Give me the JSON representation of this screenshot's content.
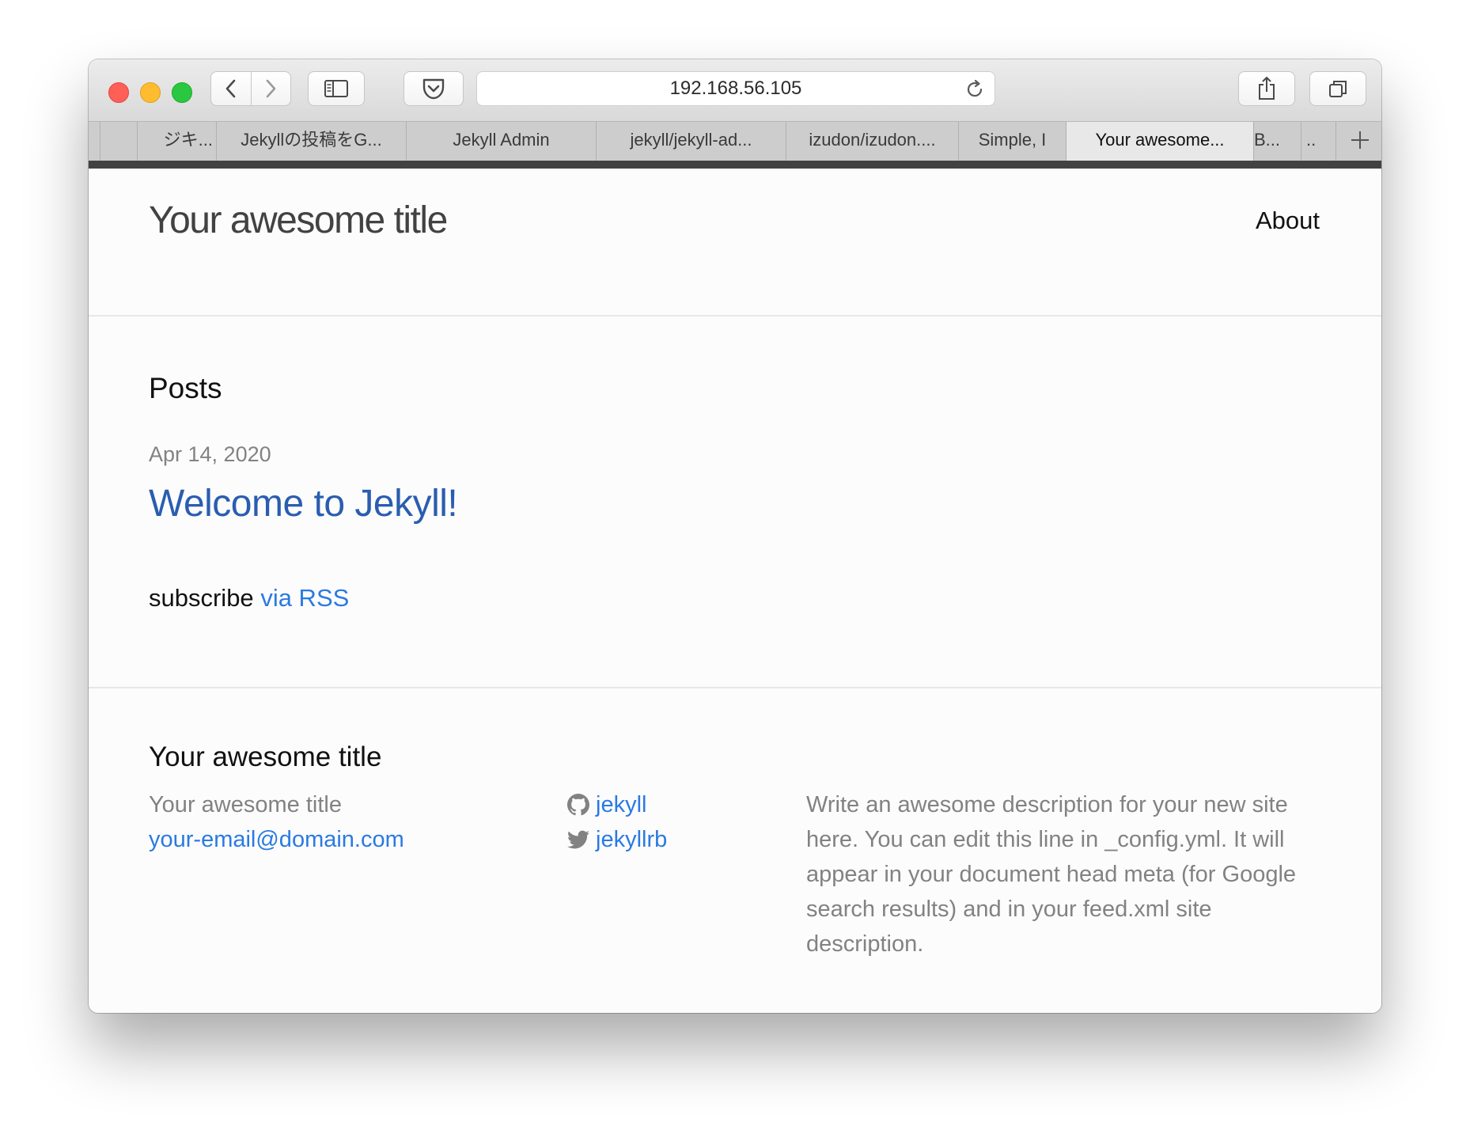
{
  "browser": {
    "url": "192.168.56.105",
    "tabs": [
      {
        "label": ""
      },
      {
        "label": "ジキ..."
      },
      {
        "label": "Jekyllの投稿をG..."
      },
      {
        "label": "Jekyll Admin"
      },
      {
        "label": "jekyll/jekyll-ad..."
      },
      {
        "label": "izudon/izudon...."
      },
      {
        "label": "Simple, I"
      },
      {
        "label": "Your awesome...",
        "active": true
      },
      {
        "label": "B..."
      },
      {
        "label": ".."
      }
    ],
    "icons": [
      "back-icon",
      "forward-icon",
      "sidebar-icon",
      "pocket-icon",
      "reload-icon",
      "share-icon",
      "tabs-overview-icon",
      "new-tab-icon"
    ]
  },
  "site": {
    "title": "Your awesome title",
    "nav": {
      "about": "About"
    }
  },
  "home": {
    "heading": "Posts",
    "posts": [
      {
        "date": "Apr 14, 2020",
        "title": "Welcome to Jekyll!"
      }
    ],
    "subscribe_text": "subscribe",
    "subscribe_link": "via RSS"
  },
  "footer": {
    "heading": "Your awesome title",
    "name": "Your awesome title",
    "email": "your-email@domain.com",
    "github": "jekyll",
    "twitter": "jekyllrb",
    "description": "Write an awesome description for your new site here. You can edit this line in _config.yml. It will appear in your document head meta (for Google search results) and in your feed.xml site description."
  },
  "colors": {
    "link": "#2a7ae2",
    "post_link": "#2a5db0",
    "muted": "#828282",
    "text": "#111111"
  }
}
